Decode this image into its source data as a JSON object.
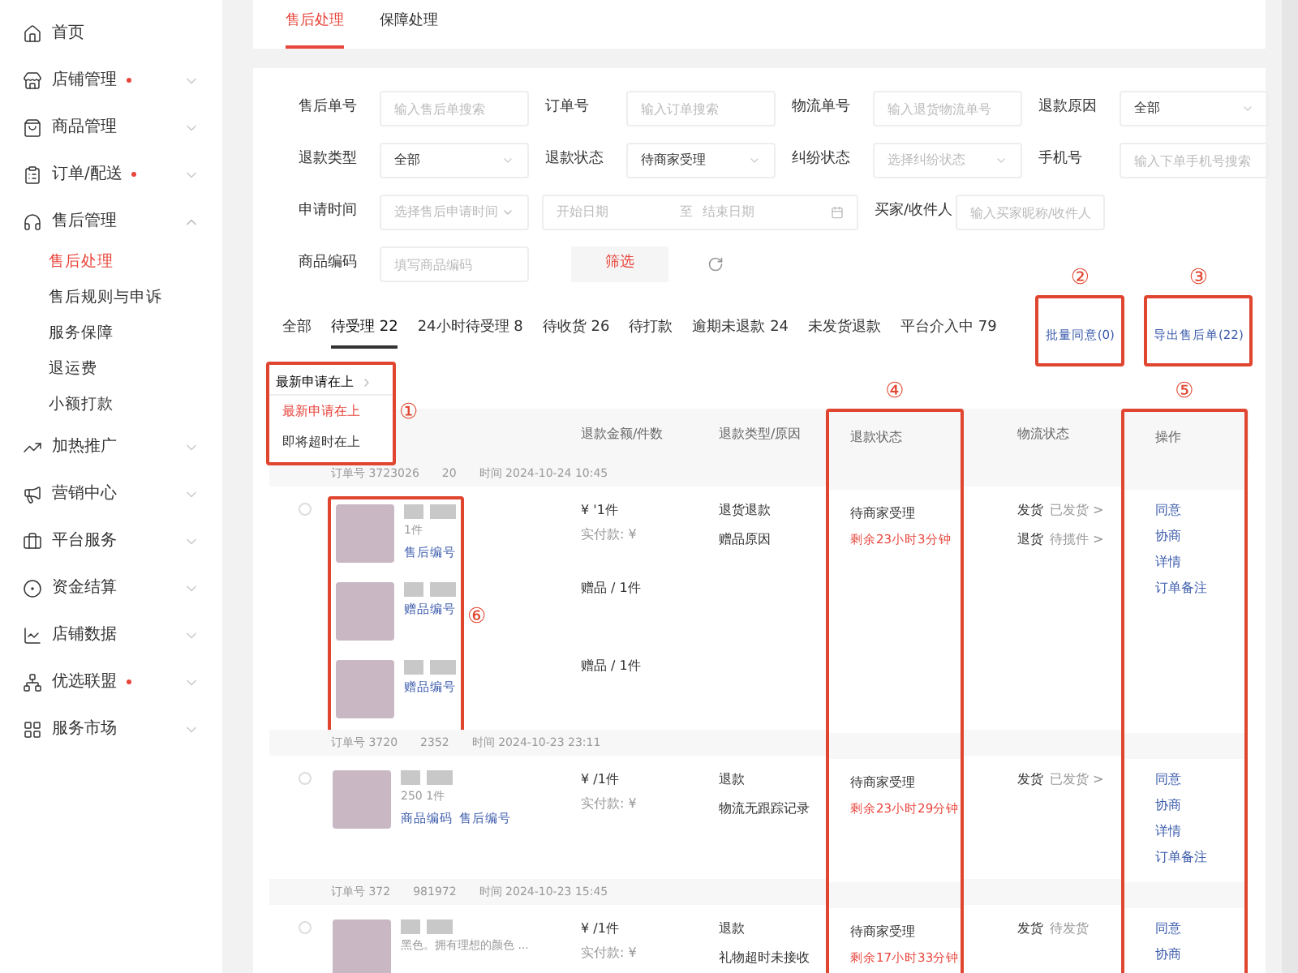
{
  "sidebar": {
    "items": [
      {
        "label": "首页"
      },
      {
        "label": "店铺管理",
        "dot": true,
        "expanded": false
      },
      {
        "label": "商品管理",
        "dot": false,
        "expanded": false
      },
      {
        "label": "订单/配送",
        "dot": true,
        "expanded": false
      },
      {
        "label": "售后管理",
        "dot": false,
        "expanded": true,
        "children": [
          {
            "label": "售后处理",
            "selected": true
          },
          {
            "label": "售后规则与申诉",
            "selected": false
          },
          {
            "label": "服务保障",
            "selected": false
          },
          {
            "label": "退运费",
            "selected": false
          },
          {
            "label": "小额打款",
            "selected": false
          }
        ]
      },
      {
        "label": "加热推广",
        "dot": false,
        "expanded": false
      },
      {
        "label": "营销中心",
        "dot": false,
        "expanded": false
      },
      {
        "label": "平台服务",
        "dot": false,
        "expanded": false
      },
      {
        "label": "资金结算",
        "dot": false,
        "expanded": false
      },
      {
        "label": "店铺数据",
        "dot": false,
        "expanded": false
      },
      {
        "label": "优选联盟",
        "dot": true,
        "expanded": false
      },
      {
        "label": "服务市场",
        "dot": false,
        "expanded": false
      }
    ]
  },
  "top_tabs": [
    {
      "label": "售后处理",
      "selected": true
    },
    {
      "label": "保障处理",
      "selected": false
    }
  ],
  "filters": [
    [
      {
        "label": "售后单号",
        "kind": "input",
        "placeholder": "输入售后单搜索"
      },
      {
        "label": "订单号",
        "kind": "input",
        "placeholder": "输入订单搜索"
      },
      {
        "label": "物流单号",
        "kind": "input",
        "placeholder": "输入退货物流单号"
      },
      {
        "label": "退款原因",
        "kind": "select",
        "value": "全部"
      }
    ],
    [
      {
        "label": "退款类型",
        "kind": "select",
        "value": "全部"
      },
      {
        "label": "退款状态",
        "kind": "select",
        "value": "待商家受理"
      },
      {
        "label": "纠纷状态",
        "kind": "select",
        "placeholder": "选择纠纷状态"
      },
      {
        "label": "手机号",
        "kind": "input",
        "placeholder": "输入下单手机号搜索"
      }
    ],
    [
      {
        "label": "申请时间",
        "kind": "daterange",
        "placeholder": "选择售后申请时间",
        "start": "开始日期",
        "separator": "至",
        "end": "结束日期"
      },
      {
        "label": "买家/收件人",
        "kind": "input",
        "placeholder": "输入买家昵称/收件人"
      }
    ],
    [
      {
        "label": "商品编码",
        "kind": "input",
        "placeholder": "填写商品编码"
      },
      {
        "label": "筛选",
        "kind": "button"
      },
      {
        "kind": "refresh"
      }
    ]
  ],
  "status_tabs": [
    {
      "label": "全部",
      "selected": false
    },
    {
      "label": "待受理 22",
      "selected": true
    },
    {
      "label": "24小时待受理 8",
      "selected": false
    },
    {
      "label": "待收货 26",
      "selected": false
    },
    {
      "label": "待打款",
      "selected": false
    },
    {
      "label": "逾期未退款 24",
      "selected": false
    },
    {
      "label": "未发货退款",
      "selected": false
    },
    {
      "label": "平台介入中 79",
      "selected": false
    }
  ],
  "batch_buttons": [
    {
      "label": "批量同意(0)",
      "annotation": "②"
    },
    {
      "label": "导出售后单(22)",
      "annotation": "③"
    }
  ],
  "sort": {
    "current": "最新申请在上",
    "annotation": "①",
    "options": [
      {
        "label": "最新申请在上",
        "selected": true
      },
      {
        "label": "即将超时在上",
        "selected": false
      }
    ]
  },
  "table": {
    "columns": [
      {
        "label": "退款金额/件数"
      },
      {
        "label": "退款类型/原因"
      },
      {
        "label": "退款状态",
        "annotation": "④"
      },
      {
        "label": "物流状态"
      },
      {
        "label": "操作",
        "annotation": "⑤"
      }
    ],
    "orders": [
      {
        "order_no": "订单号 3723026",
        "extra": "20",
        "time": "时间 2024-10-24 10:45",
        "checked": false,
        "annotation": "⑥",
        "items": [
          {
            "qty": "1件",
            "codes": [
              "售后编号"
            ],
            "amount": "¥ '1件",
            "paid": "实付款: ¥"
          },
          {
            "codes": [
              "赠品编号"
            ],
            "amount": "赠品 / 1件"
          },
          {
            "codes": [
              "赠品编号"
            ],
            "amount": "赠品 / 1件"
          }
        ],
        "refund_type": [
          "退货退款",
          "赠品原因"
        ],
        "status": "待商家受理",
        "countdown": "剩余23小时3分钟",
        "logistics": [
          {
            "label": "发货",
            "value": "已发货 >"
          },
          {
            "label": "退货",
            "value": "待揽件 >"
          }
        ],
        "actions": [
          "同意",
          "协商",
          "详情",
          "订单备注"
        ]
      },
      {
        "order_no": "订单号 3720",
        "extra": "2352",
        "time": "时间 2024-10-23 23:11",
        "checked": false,
        "items": [
          {
            "qty": "250 1件",
            "codes": [
              "商品编码",
              "售后编号"
            ],
            "amount": "¥ /1件",
            "paid": "实付款: ¥"
          }
        ],
        "refund_type": [
          "退款",
          "物流无跟踪记录"
        ],
        "status": "待商家受理",
        "countdown": "剩余23小时29分钟",
        "logistics": [
          {
            "label": "发货",
            "value": "已发货 >"
          }
        ],
        "actions": [
          "同意",
          "协商",
          "详情",
          "订单备注"
        ]
      },
      {
        "order_no": "订单号 372",
        "extra": "981972",
        "time": "时间 2024-10-23 15:45",
        "checked": false,
        "items": [
          {
            "qty": "黑色。拥有理想的颜色 ...",
            "amount": "¥ /1件",
            "paid": "实付款: ¥"
          }
        ],
        "refund_type": [
          "退款",
          "礼物超时未接收"
        ],
        "status": "待商家受理",
        "countdown": "剩余17小时33分钟",
        "logistics": [
          {
            "label": "发货",
            "value": "待发货"
          }
        ],
        "actions": [
          "同意",
          "协商"
        ]
      }
    ]
  }
}
